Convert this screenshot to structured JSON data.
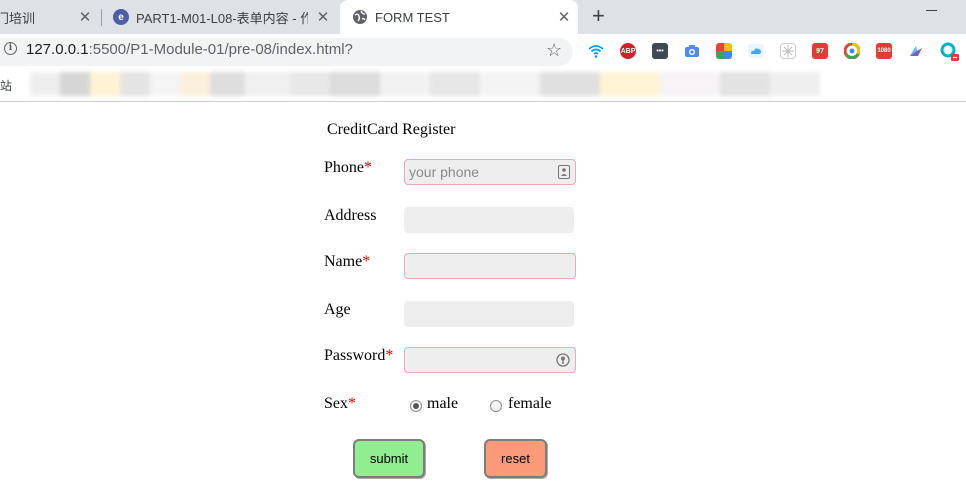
{
  "browser": {
    "tabs": [
      {
        "title": "门培训",
        "active": false
      },
      {
        "title": "PART1-M01-L08-表单内容 - 作",
        "active": false
      },
      {
        "title": "FORM TEST",
        "active": true
      }
    ],
    "new_tab_label": "+",
    "url_host": "127.0.0.1",
    "url_rest": ":5500/P1-Module-01/pre-08/index.html?",
    "bookmark_first": "站",
    "extensions": [
      {
        "name": "wifi-icon",
        "color": "#00a0e9"
      },
      {
        "name": "adblock-plus-icon",
        "color": "#d61f26",
        "text": "ABP"
      },
      {
        "name": "dots-icon",
        "color": "#3d4852",
        "text": "•••"
      },
      {
        "name": "camera-icon",
        "color": "#4c8bf5"
      },
      {
        "name": "colorful-grid-icon",
        "color": "#f4b400"
      },
      {
        "name": "cloud-icon",
        "color": "#47a6ff"
      },
      {
        "name": "snowflake-icon",
        "color": "#cfcfcf"
      },
      {
        "name": "red-square-icon",
        "color": "#e53935",
        "text": "97"
      },
      {
        "name": "chrome-ring-icon",
        "color": "#ea4335"
      },
      {
        "name": "1080-icon",
        "color": "#e53935",
        "text": "1080"
      },
      {
        "name": "bird-icon",
        "color": "#7e57c2"
      },
      {
        "name": "q-extension-icon",
        "color": "#00b3c8"
      }
    ]
  },
  "form": {
    "title": "CreditCard Register",
    "required_mark": "*",
    "fields": {
      "phone": {
        "label": "Phone",
        "placeholder": "your phone",
        "value": ""
      },
      "address": {
        "label": "Address",
        "value": ""
      },
      "name": {
        "label": "Name",
        "value": ""
      },
      "age": {
        "label": "Age",
        "value": ""
      },
      "password": {
        "label": "Password",
        "value": ""
      }
    },
    "sex": {
      "label": "Sex",
      "options": [
        {
          "label": "male",
          "checked": true
        },
        {
          "label": "female",
          "checked": false
        }
      ]
    },
    "buttons": {
      "submit": "submit",
      "reset": "reset"
    }
  }
}
